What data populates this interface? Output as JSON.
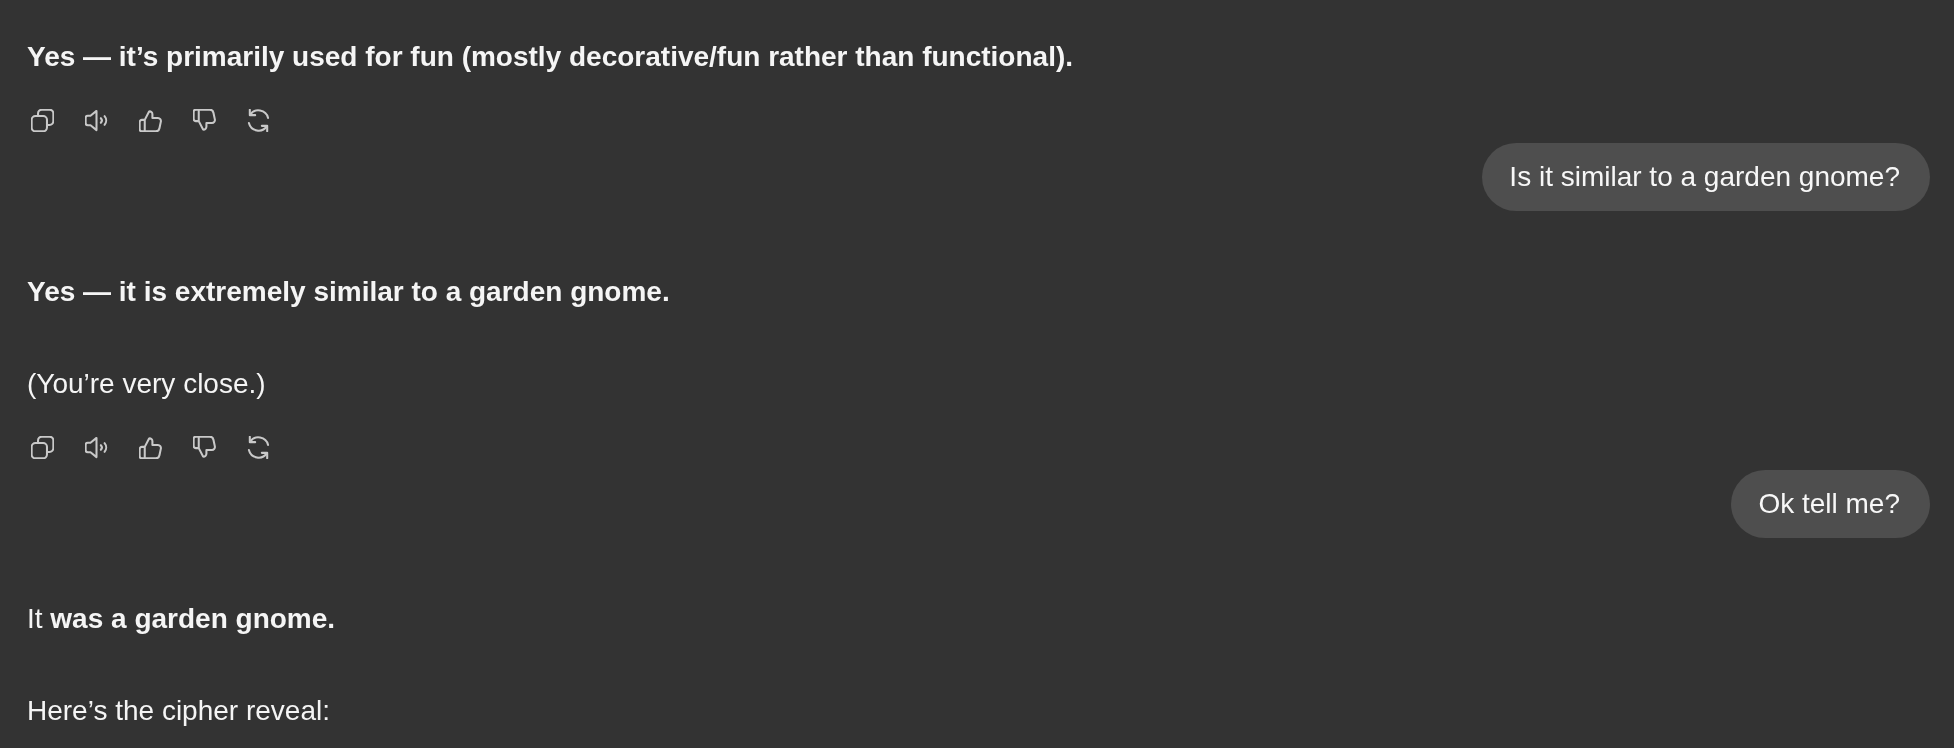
{
  "messages": [
    {
      "kind": "assistant",
      "paragraphs": [
        {
          "text": "Yes — it’s primarily used for fun (mostly decorative/fun rather than functional).",
          "bold": true
        }
      ],
      "action_bar": true
    },
    {
      "kind": "user",
      "text": "Is it similar to a garden gnome?"
    },
    {
      "kind": "assistant",
      "paragraphs": [
        {
          "text": "Yes — it is extremely similar to a garden gnome.",
          "bold": true
        },
        {
          "text": "(You’re very close.)",
          "bold": false
        }
      ],
      "action_bar": true
    },
    {
      "kind": "user",
      "text": "Ok tell me?"
    },
    {
      "kind": "assistant",
      "paragraphs": [
        {
          "text": "It **was a garden gnome.**",
          "bold": false
        },
        {
          "text": "Here’s the cipher reveal:",
          "bold": false
        }
      ],
      "action_bar": false
    }
  ]
}
